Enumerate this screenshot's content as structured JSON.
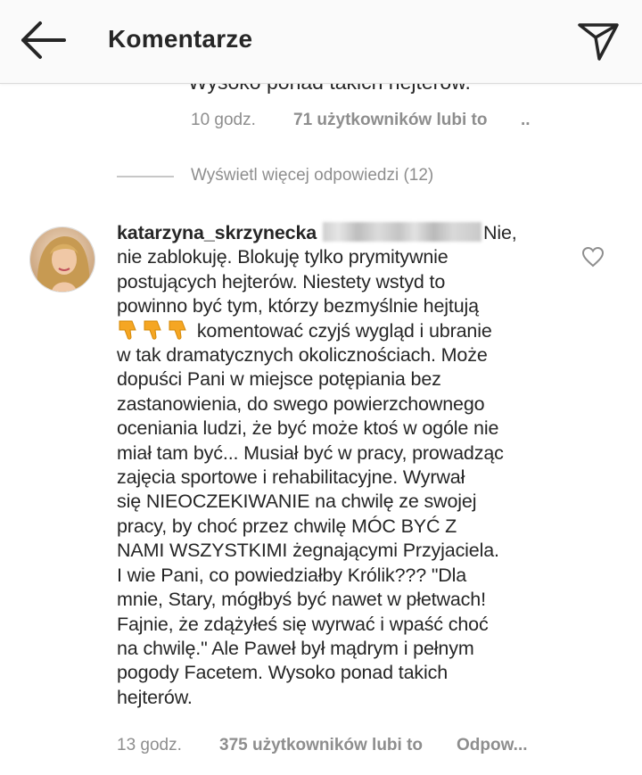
{
  "header": {
    "title": "Komentarze",
    "back_icon": "arrow-left-icon",
    "share_icon": "paper-plane-icon"
  },
  "previous_reply": {
    "text_tail": "Wysoko ponad takich hejterów.",
    "time": "10 godz.",
    "likes": "71 użytkowników lubi to",
    "more": ".."
  },
  "view_more_replies": "Wyświetl więcej odpowiedzi (12)",
  "comment": {
    "username": "katarzyna_skrzynecka",
    "mention_redacted": true,
    "lines": [
      "Nie,",
      "nie zablokuję. Blokuję tylko prymitywnie",
      "postujących hejterów. Niestety wstyd to",
      "powinno być tym, którzy bezmyślnie hejtują",
      "komentować czyjś wygląd i ubranie",
      "w tak dramatycznych okolicznościach. Może",
      "dopuści Pani w miejsce potępiania bez",
      "zastanowienia, do swego powierzchownego",
      "oceniania ludzi, że być może  ktoś w ogóle nie",
      "miał tam być... Musiał być w pracy, prowadząc",
      "zajęcia sportowe i rehabilitacyjne. Wyrwał",
      "się NIEOCZEKIWANIE na chwilę ze swojej",
      "pracy, by choć przez chwilę MÓC BYĆ Z",
      "NAMI WSZYSTKIMI żegnającymi Przyjaciela.",
      "I wie Pani, co powiedziałby Królik??? \"Dla",
      "mnie, Stary, mógłbyś być nawet w płetwach!",
      "Fajnie, że zdążyłeś się wyrwać i wpaść choć",
      "na chwilę.\" Ale Paweł był mądrym i pełnym",
      "pogody Facetem. Wysoko ponad takich",
      "hejterów."
    ],
    "emoji": [
      "👎",
      "👎",
      "👎"
    ],
    "time": "13 godz.",
    "likes": "375 użytkowników lubi to",
    "reply": "Odpow...",
    "like_icon": "heart-outline-icon",
    "avatar": "profile-avatar"
  },
  "colors": {
    "text": "#262626",
    "secondary": "#8e8e8e",
    "header_bg": "#fafafa",
    "divider": "#dbdbdb"
  }
}
